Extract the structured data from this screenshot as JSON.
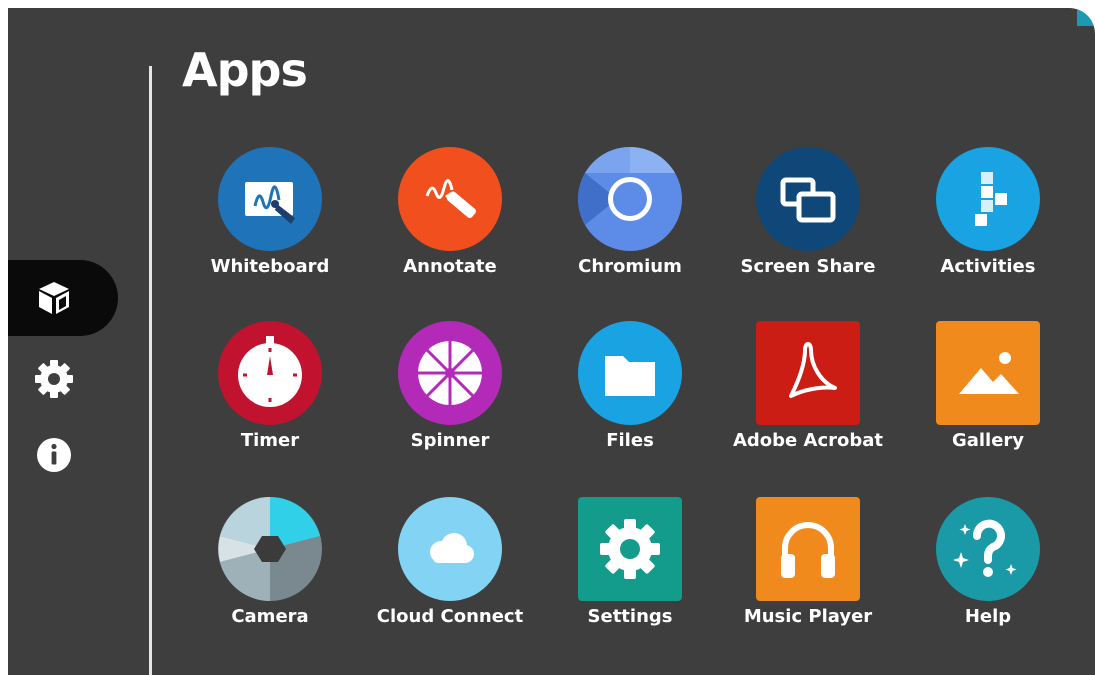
{
  "title": "Apps",
  "sidebar": {
    "items": [
      {
        "name": "apps",
        "icon": "cube-icon",
        "active": true
      },
      {
        "name": "settings",
        "icon": "gear-icon",
        "active": false
      },
      {
        "name": "info",
        "icon": "info-icon",
        "active": false
      }
    ]
  },
  "apps": [
    {
      "label": "Whiteboard",
      "icon": "whiteboard-icon",
      "color": "#1f73b8"
    },
    {
      "label": "Annotate",
      "icon": "annotate-icon",
      "color": "#f1501e"
    },
    {
      "label": "Chromium",
      "icon": "chromium-icon",
      "color": "#5d8ce8"
    },
    {
      "label": "Screen Share",
      "icon": "screen-share-icon",
      "color": "#0f4778"
    },
    {
      "label": "Activities",
      "icon": "activities-icon",
      "color": "#1aa3e3"
    },
    {
      "label": "Timer",
      "icon": "timer-icon",
      "color": "#c1132f"
    },
    {
      "label": "Spinner",
      "icon": "spinner-icon",
      "color": "#b329b8"
    },
    {
      "label": "Files",
      "icon": "folder-icon",
      "color": "#1aa3e3"
    },
    {
      "label": "Adobe Acrobat",
      "icon": "acrobat-icon",
      "color": "#cc1d15"
    },
    {
      "label": "Gallery",
      "icon": "gallery-icon",
      "color": "#f08a1d"
    },
    {
      "label": "Camera",
      "icon": "camera-icon",
      "color": "#7a8890"
    },
    {
      "label": "Cloud Connect",
      "icon": "cloud-icon",
      "color": "#82d3f4"
    },
    {
      "label": "Settings",
      "icon": "settings-icon",
      "color": "#139b8b"
    },
    {
      "label": "Music Player",
      "icon": "headphones-icon",
      "color": "#f08a1d"
    },
    {
      "label": "Help",
      "icon": "help-icon",
      "color": "#1a9aa6"
    }
  ]
}
